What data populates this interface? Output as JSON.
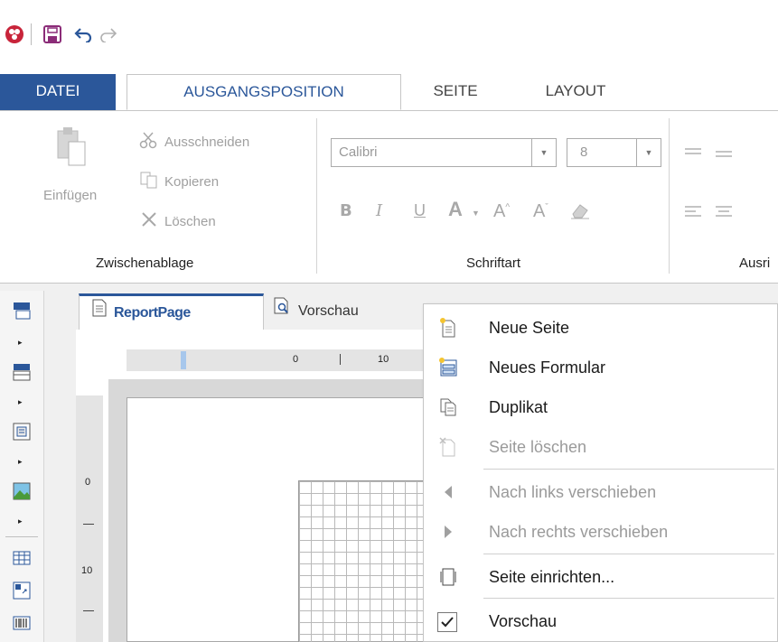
{
  "quick_access": {
    "app_icon": "app-logo-icon",
    "save_icon": "save-icon",
    "undo_icon": "undo-icon",
    "redo_icon": "redo-icon"
  },
  "ribbon_tabs": {
    "datei": "DATEI",
    "ausgangsposition": "AUSGANGSPOSITION",
    "seite": "SEITE",
    "layout": "LAYOUT"
  },
  "clipboard": {
    "paste": "Einfügen",
    "cut": "Ausschneiden",
    "copy": "Kopieren",
    "delete": "Löschen",
    "group_label": "Zwischenablage"
  },
  "font": {
    "family": "Calibri",
    "size": "8",
    "bold": "B",
    "italic": "I",
    "underline": "U",
    "font_color": "A",
    "grow": "A",
    "shrink": "A",
    "group_label": "Schriftart"
  },
  "alignment": {
    "group_label": "Ausri"
  },
  "doc_tabs": {
    "report_page": "ReportPage",
    "preview": "Vorschau"
  },
  "rulers": {
    "h_zero": "0",
    "h_ten": "10",
    "v_zero": "0",
    "v_ten": "10"
  },
  "context_menu": {
    "items": [
      {
        "label": "Neue Seite",
        "enabled": true,
        "icon": "new-page-icon"
      },
      {
        "label": "Neues Formular",
        "enabled": true,
        "icon": "new-form-icon"
      },
      {
        "label": "Duplikat",
        "enabled": true,
        "icon": "duplicate-icon"
      },
      {
        "label": "Seite löschen",
        "enabled": false,
        "icon": "delete-page-icon"
      },
      {
        "label": "Nach links verschieben",
        "enabled": false,
        "icon": "arrow-left-icon"
      },
      {
        "label": "Nach rechts verschieben",
        "enabled": false,
        "icon": "arrow-right-icon"
      },
      {
        "label": "Seite einrichten...",
        "enabled": true,
        "icon": "page-setup-icon"
      },
      {
        "label": "Vorschau",
        "enabled": true,
        "checked": true,
        "icon": "checkmark-icon"
      }
    ]
  },
  "colors": {
    "accent": "#2b579a",
    "disabled": "#9a9a9a"
  }
}
